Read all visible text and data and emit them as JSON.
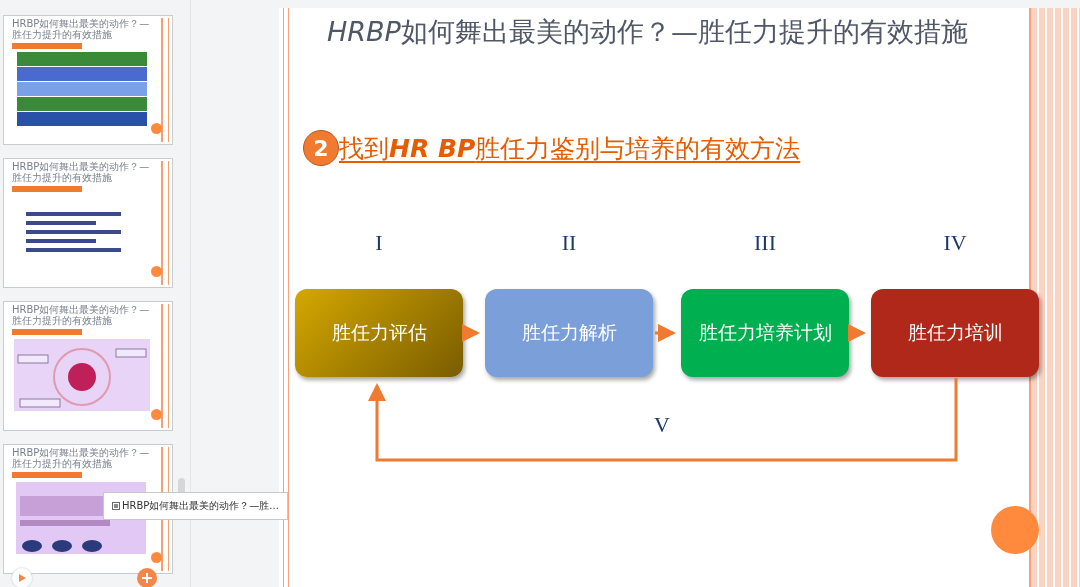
{
  "thumbnails": [
    {
      "title": "HRBP如何舞出最美的动作？—胜任力提升的有效措施",
      "kind": "stack",
      "selected": false
    },
    {
      "title": "HRBP如何舞出最美的动作？—胜任力提升的有效措施",
      "kind": "list",
      "selected": false
    },
    {
      "title": "HRBP如何舞出最美的动作？—胜任力提升的有效措施",
      "kind": "radial",
      "selected": false
    },
    {
      "title": "HRBP如何舞出最美的动作？—胜任力提升的有效措施",
      "kind": "map",
      "selected": false
    }
  ],
  "tooltip": "HRBP如何舞出最美的动作？—胜...",
  "slide": {
    "title_lead": "HRBP",
    "title_rest": "如何舞出最美的动作？—胜任力提升的有效措施",
    "section_number": "2",
    "section_title_parts": [
      "找到",
      "HR BP",
      "胜任力鉴别与培养的有效方法"
    ],
    "stages": [
      {
        "numeral": "I",
        "label": "胜任力评估",
        "color": "#d4a800"
      },
      {
        "numeral": "II",
        "label": "胜任力解析",
        "color": "#7b9fd9"
      },
      {
        "numeral": "III",
        "label": "胜任力培养计划",
        "color": "#00b050"
      },
      {
        "numeral": "IV",
        "label": "胜任力培训",
        "color": "#b0281a"
      }
    ],
    "loop_label": "V"
  }
}
